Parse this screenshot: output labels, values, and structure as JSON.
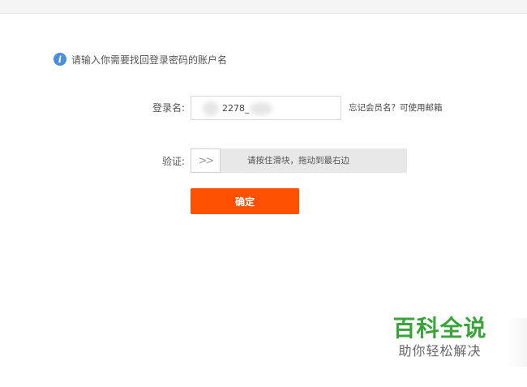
{
  "notice": {
    "icon": "info-icon",
    "text": "请输入你需要找回登录密码的账户名"
  },
  "form": {
    "username_label": "登录名:",
    "username_value": "2278_",
    "forgot_link": "忘记会员名？可使用邮箱",
    "verify_label": "验证:",
    "slider_handle": ">>",
    "slider_text": "请按住滑块，拖动到最右边",
    "confirm_label": "确定"
  },
  "watermark": {
    "title": "百科全说",
    "subtitle": "助你轻松解决"
  },
  "colors": {
    "accent": "#ff4f00",
    "info": "#4a90d9",
    "watermark_green": "#3aa33a"
  }
}
